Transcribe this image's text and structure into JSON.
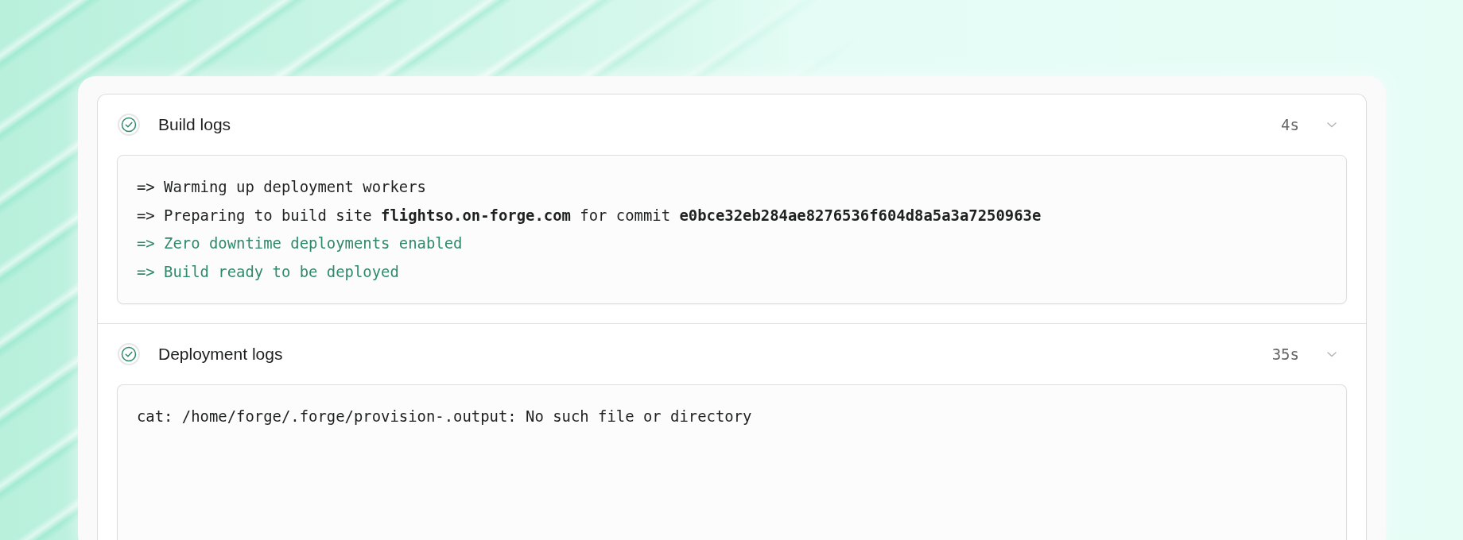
{
  "sections": [
    {
      "title": "Build logs",
      "kind": "success",
      "duration": "4s",
      "lines": [
        {
          "kind": "normal",
          "text": "=> Warming up deployment workers"
        },
        {
          "kind": "normal",
          "text": "=> Preparing to build site **flightso.on-forge.com** for commit **e0bce32eb284ae8276536f604d8a5a3a7250963e**"
        },
        {
          "kind": "success",
          "text": "=> Zero downtime deployments enabled"
        },
        {
          "kind": "success",
          "text": "=> Build ready to be deployed"
        }
      ]
    },
    {
      "title": "Deployment logs",
      "kind": "success",
      "duration": "35s",
      "lines": [
        {
          "kind": "normal",
          "text": "cat: /home/forge/.forge/provision-.output: No such file or directory"
        }
      ]
    }
  ]
}
